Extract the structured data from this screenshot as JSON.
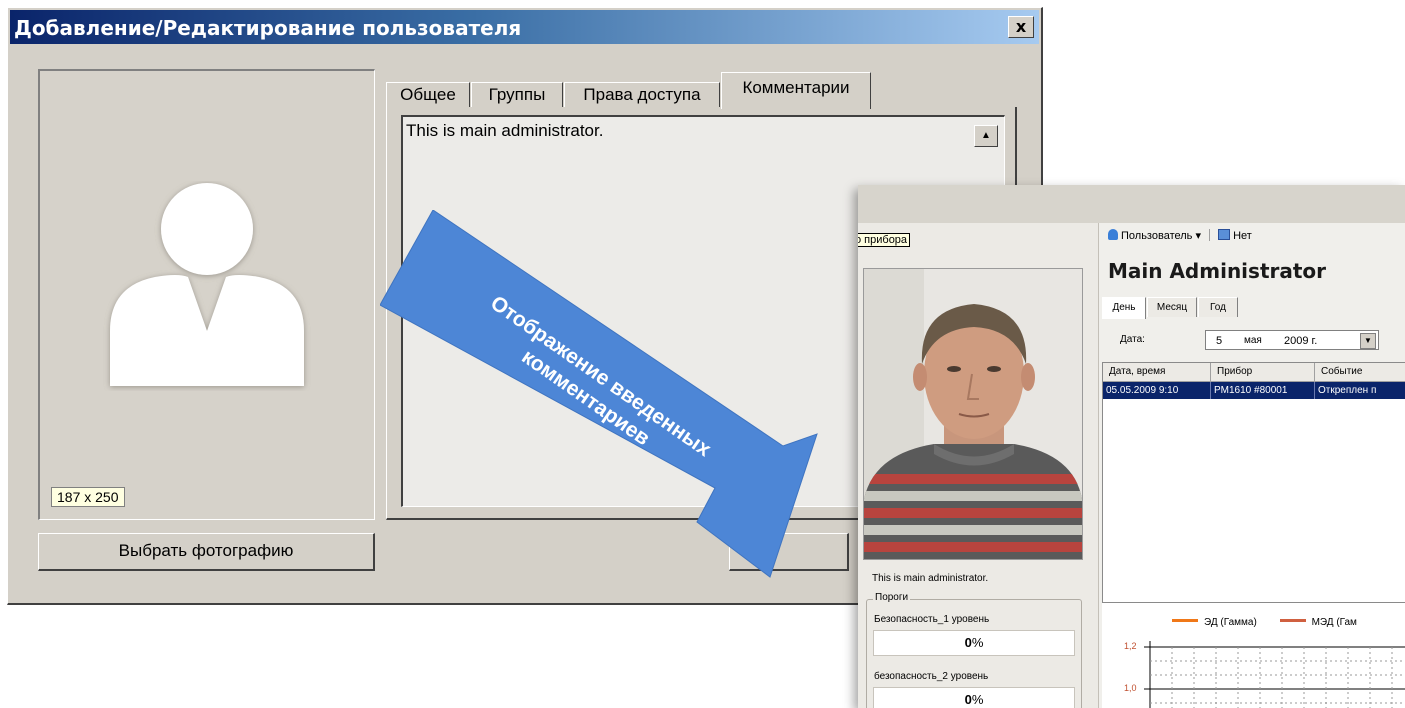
{
  "dialog": {
    "title": "Добавление/Редактирование пользователя",
    "close_label": "x",
    "photo_size": "187 x 250",
    "choose_photo_label": "Выбрать фотографию",
    "tabs": [
      {
        "label": "Общее"
      },
      {
        "label": "Группы"
      },
      {
        "label": "Права доступа"
      },
      {
        "label": "Комментарии",
        "active": true
      }
    ],
    "comment_text": "This is main administrator."
  },
  "arrow": {
    "text_line1": "Отображение введенных",
    "text_line2": "комментариев",
    "color": "#4d86d6"
  },
  "inset": {
    "tooltip": "о прибора",
    "user_menu": "Пользователь",
    "none_label": "Нет",
    "user_name": "Main Administrator",
    "tabs": [
      "День",
      "Месяц",
      "Год"
    ],
    "date_label": "Дата:",
    "date_day": "5",
    "date_month": "мая",
    "date_year": "2009 г.",
    "table": {
      "headers": [
        "Дата, время",
        "Прибор",
        "Событие"
      ],
      "rows": [
        [
          "05.05.2009 9:10",
          "PM1610 #80001",
          "Откреплен п"
        ]
      ]
    },
    "comment": "This is main administrator.",
    "thresholds": {
      "title": "Пороги",
      "items": [
        {
          "label": "Безопасность_1 уровень",
          "value": "0",
          "unit": "%"
        },
        {
          "label": "безопасность_2 уровень",
          "value": "0",
          "unit": "%"
        }
      ]
    },
    "chart": {
      "legend": [
        "ЭД (Гамма)",
        "МЭД (Гам"
      ],
      "yticks": [
        "1,2",
        "1,0"
      ]
    }
  }
}
